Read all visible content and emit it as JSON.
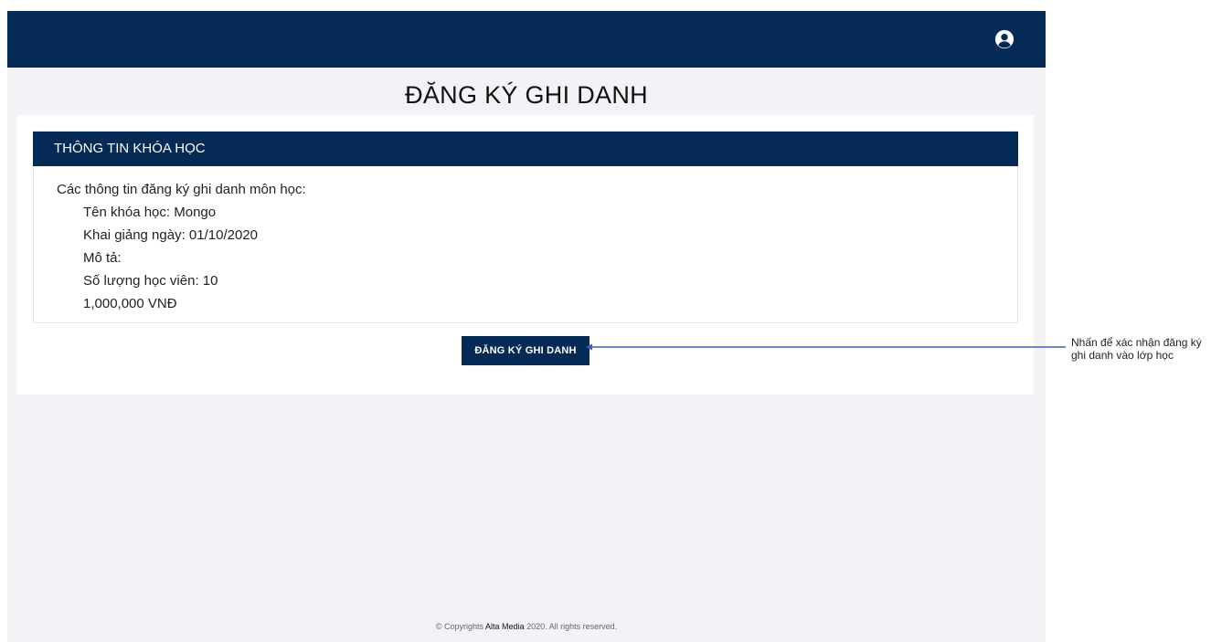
{
  "header": {
    "user_icon": "user-circle-icon"
  },
  "page": {
    "title": "ĐĂNG KÝ GHI DANH"
  },
  "course_panel": {
    "header": "THÔNG TIN KHÓA HỌC",
    "intro": "Các thông tin đăng ký ghi danh môn học:",
    "items": [
      "Tên khóa học: Mongo",
      "Khai giảng ngày: 01/10/2020",
      "Mô tả:",
      "Số lượng học viên: 10",
      "1,000,000 VNĐ"
    ]
  },
  "actions": {
    "register_label": "ĐĂNG KÝ GHI DANH"
  },
  "footer": {
    "prefix": "© Copyrights ",
    "brand": "Alta Media",
    "suffix": " 2020. All rights reserved."
  },
  "annotation": {
    "text": "Nhấn để xác nhận đăng ký ghi danh vào lớp học",
    "color": "#3d5fc4"
  },
  "colors": {
    "primary": "#042a55",
    "background": "#f3f3f7"
  }
}
